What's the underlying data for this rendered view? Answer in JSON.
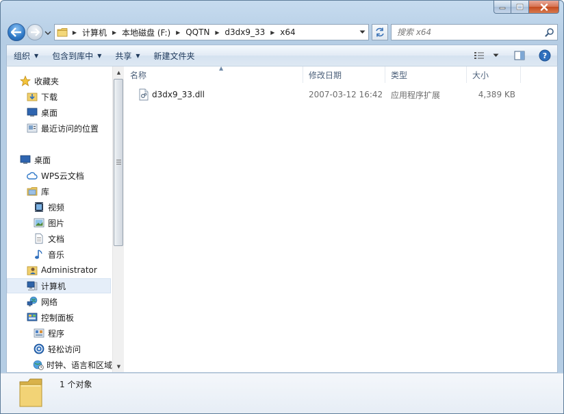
{
  "window": {
    "controls": {
      "minimize": "minimize",
      "maximize": "maximize",
      "close": "close"
    }
  },
  "address": {
    "crumbs": [
      "计算机",
      "本地磁盘 (F:)",
      "QQTN",
      "d3dx9_33",
      "x64"
    ]
  },
  "search": {
    "placeholder": "搜索 x64"
  },
  "toolbar": {
    "organize": "组织",
    "include_library": "包含到库中",
    "share": "共享",
    "new_folder": "新建文件夹"
  },
  "nav": {
    "favorites": "收藏夹",
    "downloads": "下载",
    "desktop_fav": "桌面",
    "recent": "最近访问的位置",
    "desktop": "桌面",
    "wps": "WPS云文档",
    "libraries": "库",
    "videos": "视频",
    "pictures": "图片",
    "documents": "文档",
    "music": "音乐",
    "administrator": "Administrator",
    "computer": "计算机",
    "network": "网络",
    "control_panel": "控制面板",
    "programs": "程序",
    "ease_access": "轻松访问",
    "clock_region": "时钟、语言和区域"
  },
  "columns": {
    "name": "名称",
    "date": "修改日期",
    "type": "类型",
    "size": "大小"
  },
  "files": [
    {
      "name": "d3dx9_33.dll",
      "date": "2007-03-12 16:42",
      "type": "应用程序扩展",
      "size": "4,389 KB"
    }
  ],
  "details": {
    "count": "1 个对象"
  },
  "colors": {
    "accent": "#1e395b",
    "window_frame": "#b5cde4",
    "selection": "#e5eef9"
  }
}
